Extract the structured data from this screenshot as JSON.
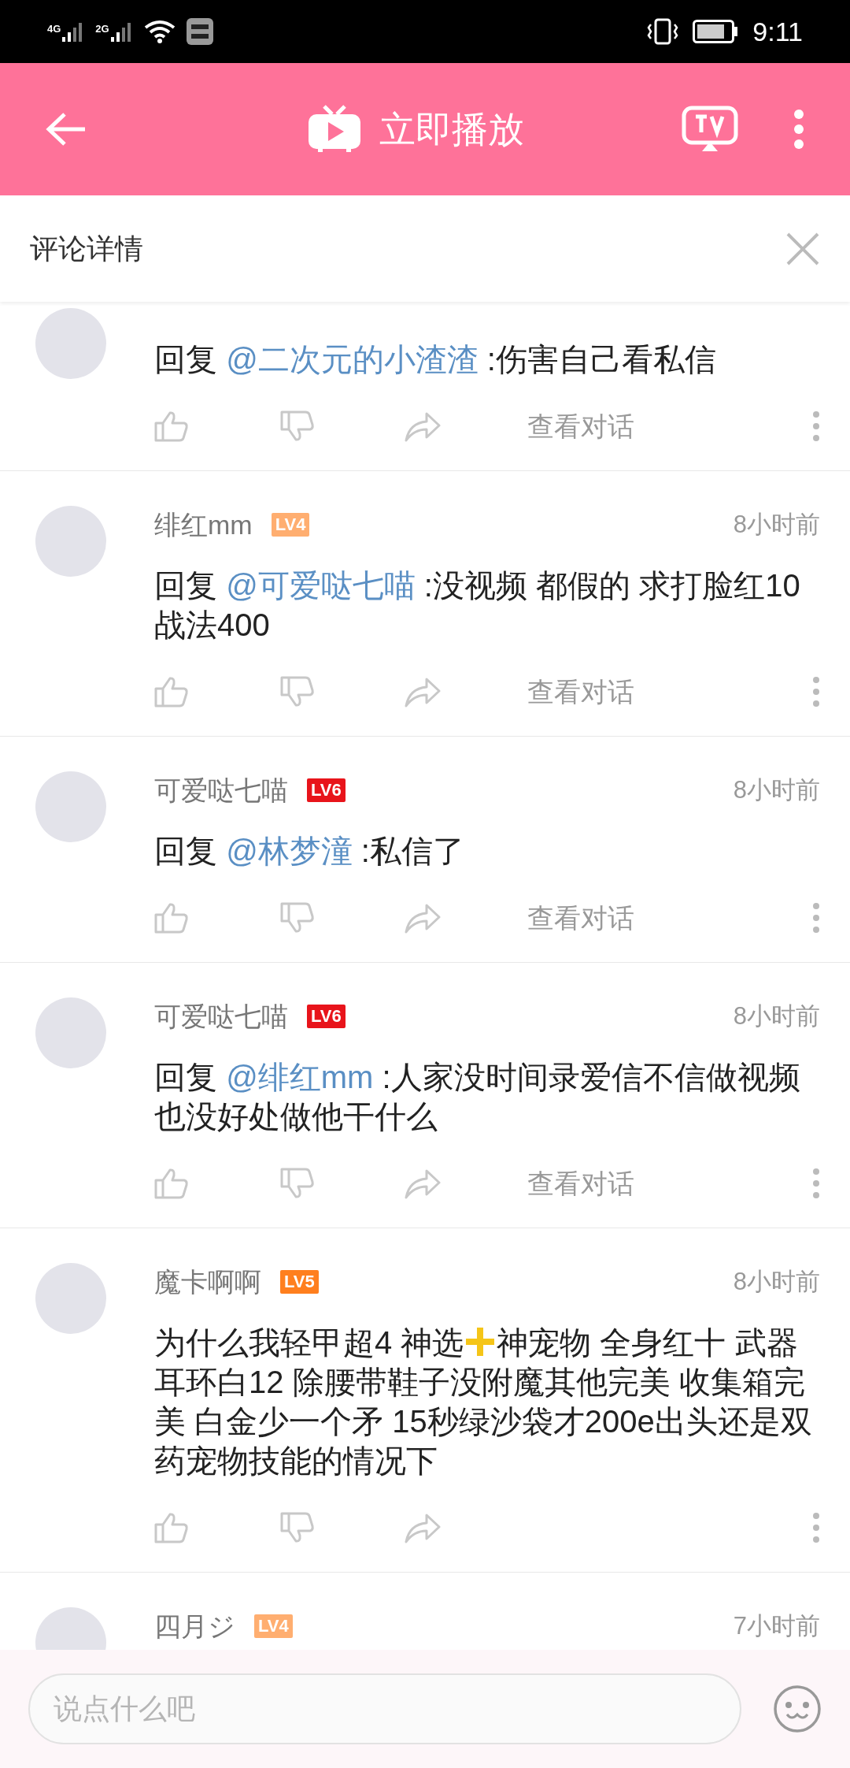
{
  "status_bar": {
    "network_1": "4G",
    "network_2": "2G",
    "time": "9:11"
  },
  "header": {
    "title": "立即播放"
  },
  "panel": {
    "title": "评论详情"
  },
  "comments": [
    {
      "reply_prefix": "回复",
      "mention": "@二次元的小渣渣",
      "body": [
        {
          "kind": "text",
          "text": ":伤害自己看私信"
        }
      ],
      "view_conversation": "查看对话"
    },
    {
      "user": "绯红mm",
      "level": {
        "label": "LV4",
        "color": "#ffae70"
      },
      "time": "8小时前",
      "reply_prefix": "回复",
      "mention": "@可爱哒七喵",
      "body": [
        {
          "kind": "text",
          "text": ":没视频 都假的 求打脸红10战法400"
        }
      ],
      "view_conversation": "查看对话"
    },
    {
      "user": "可爱哒七喵",
      "level": {
        "label": "LV6",
        "color": "#e8141b"
      },
      "time": "8小时前",
      "reply_prefix": "回复",
      "mention": "@林梦潼",
      "body": [
        {
          "kind": "text",
          "text": ":私信了"
        }
      ],
      "view_conversation": "查看对话"
    },
    {
      "user": "可爱哒七喵",
      "level": {
        "label": "LV6",
        "color": "#e8141b"
      },
      "time": "8小时前",
      "reply_prefix": "回复",
      "mention": "@绯红mm",
      "body": [
        {
          "kind": "text",
          "text": ":人家没时间录爱信不信做视频也没好处做他干什么"
        }
      ],
      "view_conversation": "查看对话"
    },
    {
      "user": "魔卡啊啊",
      "level": {
        "label": "LV5",
        "color": "#ff7f1e"
      },
      "time": "8小时前",
      "body": [
        {
          "kind": "text",
          "text": "为什么我轻甲超4 神选"
        },
        {
          "kind": "plus_emoji"
        },
        {
          "kind": "text",
          "text": "神宠物 全身红十 武器耳环白12 除腰带鞋子没附魔其他完美 收集箱完美 白金少一个矛 15秒绿沙袋才200e出头还是双药宠物技能的情况下"
        }
      ]
    },
    {
      "user": "四月ジ",
      "level": {
        "label": "LV4",
        "color": "#ffae70"
      },
      "time": "7小时前"
    }
  ],
  "composer": {
    "placeholder": "说点什么吧"
  }
}
